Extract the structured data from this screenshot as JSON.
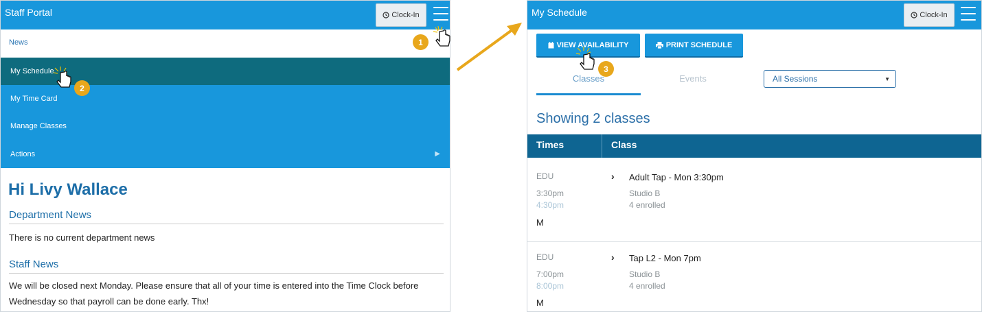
{
  "left_panel": {
    "header": {
      "title": "Staff Portal",
      "clock_in_label": "Clock-In"
    },
    "news_link": "News",
    "menu": {
      "items": [
        {
          "label": "My Schedule"
        },
        {
          "label": "My Time Card"
        },
        {
          "label": "Manage Classes"
        },
        {
          "label": "Actions"
        }
      ]
    },
    "greeting": "Hi Livy Wallace",
    "department_news": {
      "heading": "Department News",
      "text": "There is no current department news"
    },
    "staff_news": {
      "heading": "Staff News",
      "text": "We will be closed next Monday. Please ensure that all of your time is entered into the Time Clock before Wednesday so that payroll can be done early. Thx!"
    }
  },
  "right_panel": {
    "header": {
      "title": "My Schedule",
      "clock_in_label": "Clock-In"
    },
    "buttons": {
      "view_availability": "VIEW AVAILABILITY",
      "print_schedule": "PRINT SCHEDULE"
    },
    "tabs": [
      {
        "label": "Classes"
      },
      {
        "label": "Events"
      }
    ],
    "session_select": {
      "selected": "All Sessions"
    },
    "showing_text": "Showing 2 classes",
    "table": {
      "headers": {
        "times": "Times",
        "class": "Class"
      },
      "rows": [
        {
          "program": "EDU",
          "start": "3:30pm",
          "end": "4:30pm",
          "day": "M",
          "class_name": "Adult Tap - Mon 3:30pm",
          "studio": "Studio B",
          "enrolled": "4 enrolled"
        },
        {
          "program": "EDU",
          "start": "7:00pm",
          "end": "8:00pm",
          "day": "M",
          "class_name": "Tap L2 - Mon 7pm",
          "studio": "Studio B",
          "enrolled": "4 enrolled"
        }
      ]
    }
  },
  "callouts": {
    "step1": "1",
    "step2": "2",
    "step3": "3"
  },
  "colors": {
    "header_blue": "#1897dc",
    "active_menu_teal": "#0e6b7e",
    "table_header": "#0e6592",
    "callout_gold": "#e8a71c",
    "link_blue": "#1d6ea8"
  }
}
